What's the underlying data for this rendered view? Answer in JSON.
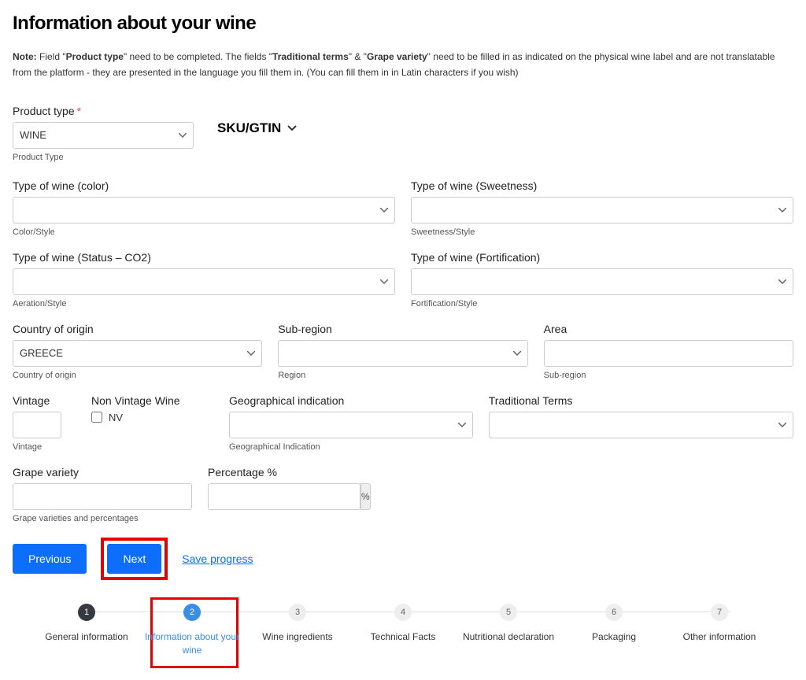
{
  "heading": "Information about your wine",
  "note": {
    "prefix": "Note:",
    "t1": " Field \"",
    "b1": "Product type",
    "t2": "\" need to be completed. The fields \"",
    "b2": "Traditional terms",
    "t3": "\" & \"",
    "b3": "Grape variety",
    "t4": "\" need to be filled in as indicated on the physical wine label and are not translatable from the platform - they are presented in the language you fill them in. (You can fill them in in Latin characters if you wish)"
  },
  "sku": "SKU/GTIN",
  "fields": {
    "product_type": {
      "label": "Product type",
      "value": "WINE",
      "helper": "Product Type"
    },
    "color": {
      "label": "Type of wine (color)",
      "value": "",
      "helper": "Color/Style"
    },
    "sweetness": {
      "label": "Type of wine (Sweetness)",
      "value": "",
      "helper": "Sweetness/Style"
    },
    "status": {
      "label": "Type of wine (Status – CO2)",
      "value": "",
      "helper": "Aeration/Style"
    },
    "fort": {
      "label": "Type of wine (Fortification)",
      "value": "",
      "helper": "Fortification/Style"
    },
    "country": {
      "label": "Country of origin",
      "value": "GREECE",
      "helper": "Country of origin"
    },
    "subregion": {
      "label": "Sub-region",
      "value": "",
      "helper": "Region"
    },
    "area": {
      "label": "Area",
      "value": "",
      "helper": "Sub-region"
    },
    "vintage": {
      "label": "Vintage",
      "value": "",
      "helper": "Vintage"
    },
    "nv": {
      "label": "Non Vintage Wine",
      "check": "NV"
    },
    "geo": {
      "label": "Geographical indication",
      "value": "",
      "helper": "Geographical Indication"
    },
    "trad": {
      "label": "Traditional Terms",
      "value": ""
    },
    "grape": {
      "label": "Grape variety",
      "value": "",
      "helper": "Grape varieties and percentages"
    },
    "pct": {
      "label": "Percentage %",
      "unit": "%"
    }
  },
  "actions": {
    "prev": "Previous",
    "next": "Next",
    "save": "Save progress"
  },
  "steps": [
    {
      "num": "1",
      "label": "General information"
    },
    {
      "num": "2",
      "label": "Information about your wine"
    },
    {
      "num": "3",
      "label": "Wine ingredients"
    },
    {
      "num": "4",
      "label": "Technical Facts"
    },
    {
      "num": "5",
      "label": "Nutritional declaration"
    },
    {
      "num": "6",
      "label": "Packaging"
    },
    {
      "num": "7",
      "label": "Other information"
    }
  ]
}
